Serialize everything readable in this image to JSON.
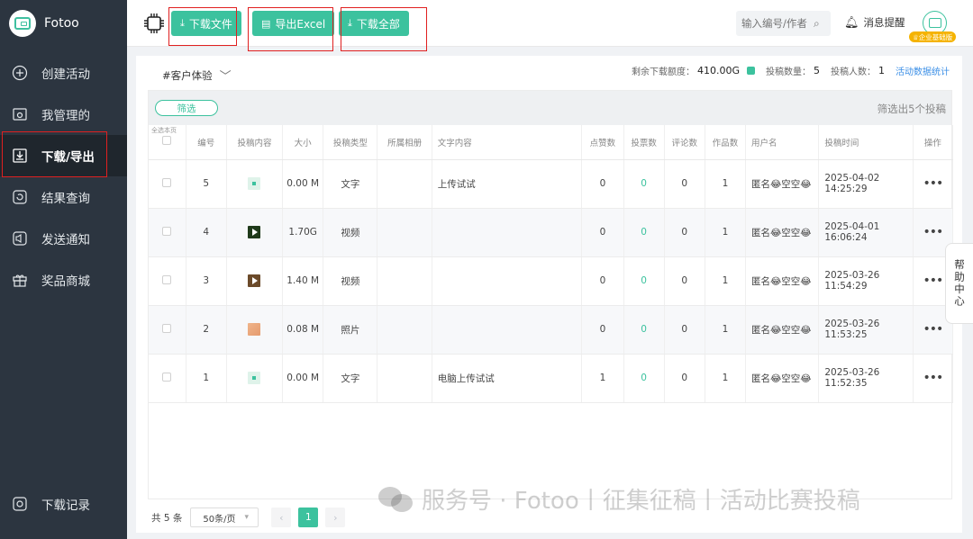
{
  "app": {
    "name": "Fotoo"
  },
  "sidebar": {
    "items": [
      {
        "label": "创建活动",
        "icon": "plus-circle-icon"
      },
      {
        "label": "我管理的",
        "icon": "settings-folder-icon"
      },
      {
        "label": "下载/导出",
        "icon": "download-icon",
        "active": true
      },
      {
        "label": "结果查询",
        "icon": "refresh-icon"
      },
      {
        "label": "发送通知",
        "icon": "speaker-icon"
      },
      {
        "label": "奖品商城",
        "icon": "gift-icon"
      }
    ],
    "bottom": {
      "label": "下载记录",
      "icon": "record-icon"
    }
  },
  "toolbar": {
    "download_file": "下载文件",
    "export_excel": "导出Excel",
    "download_all": "下载全部"
  },
  "search": {
    "placeholder": "输入编号/作者"
  },
  "notify": {
    "label": "消息提醒"
  },
  "user": {
    "badge": "企业基础版"
  },
  "activity": {
    "name": "#客户体验"
  },
  "stats": {
    "quota_label": "剩余下载额度：",
    "quota_value": "410.00G",
    "count_label": "投稿数量：",
    "count_value": "5",
    "people_label": "投稿人数：",
    "people_value": "1",
    "link": "活动数据统计"
  },
  "filter": {
    "button": "筛选",
    "result": "筛选出5个投稿"
  },
  "table": {
    "select_all": "全选本页",
    "columns": [
      "编号",
      "投稿内容",
      "大小",
      "投稿类型",
      "所属相册",
      "文字内容",
      "点赞数",
      "投票数",
      "评论数",
      "作品数",
      "用户名",
      "投稿时间",
      "操作"
    ],
    "rows": [
      {
        "id": "5",
        "thumb": "text",
        "size": "0.00 M",
        "type": "文字",
        "album": "",
        "text": "上传试试",
        "likes": "0",
        "votes": "0",
        "comments": "0",
        "works": "1",
        "user": "匿名😂空空😂",
        "time": "2025-04-02 14:25:29",
        "op": "•••"
      },
      {
        "id": "4",
        "thumb": "video",
        "size": "1.70G",
        "type": "视频",
        "album": "",
        "text": "",
        "likes": "0",
        "votes": "0",
        "comments": "0",
        "works": "1",
        "user": "匿名😂空空😂",
        "time": "2025-04-01 16:06:24",
        "op": "•••"
      },
      {
        "id": "3",
        "thumb": "video2",
        "size": "1.40 M",
        "type": "视频",
        "album": "",
        "text": "",
        "likes": "0",
        "votes": "0",
        "comments": "0",
        "works": "1",
        "user": "匿名😂空空😂",
        "time": "2025-03-26 11:54:29",
        "op": "•••"
      },
      {
        "id": "2",
        "thumb": "photo",
        "size": "0.08 M",
        "type": "照片",
        "album": "",
        "text": "",
        "likes": "0",
        "votes": "0",
        "comments": "0",
        "works": "1",
        "user": "匿名😂空空😂",
        "time": "2025-03-26 11:53:25",
        "op": "•••"
      },
      {
        "id": "1",
        "thumb": "text",
        "size": "0.00 M",
        "type": "文字",
        "album": "",
        "text": "电脑上传试试",
        "likes": "1",
        "votes": "0",
        "comments": "0",
        "works": "1",
        "user": "匿名😂空空😂",
        "time": "2025-03-26 11:52:35",
        "op": "•••"
      }
    ]
  },
  "pager": {
    "total": "共 5 条",
    "page_size": "50条/页",
    "current": "1",
    "prev": "‹",
    "next": "›"
  },
  "help": {
    "label": "帮助中心"
  },
  "watermark": {
    "text": "服务号 · Fotoo丨征集征稿丨活动比赛投稿"
  },
  "colors": {
    "accent": "#3cc29e",
    "sidebar": "#2c3540",
    "highlight_box": "#e02020",
    "link": "#3a8ee6"
  }
}
